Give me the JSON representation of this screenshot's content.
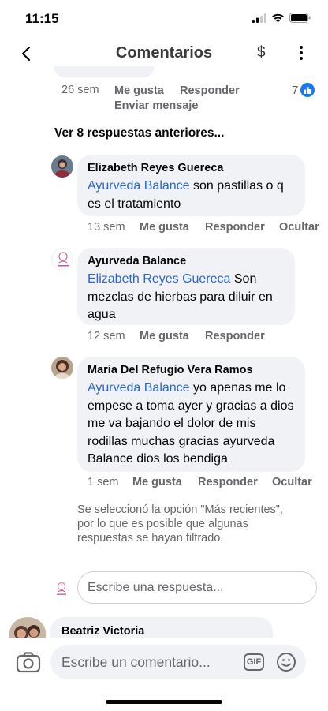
{
  "status_bar": {
    "time": "11:15"
  },
  "header": {
    "title": "Comentarios",
    "dollar_symbol": "$"
  },
  "parent_comment": {
    "time": "26 sem",
    "like_label": "Me gusta",
    "reply_label": "Responder",
    "send_message_label": "Enviar mensaje",
    "reaction_count": "7"
  },
  "previous_replies_label": "Ver 8 respuestas anteriores...",
  "replies": [
    {
      "author": "Elizabeth Reyes Guereca",
      "mention": "Ayurveda Balance",
      "text": " son pastillas o q es el tratamiento",
      "time": "13 sem",
      "like_label": "Me gusta",
      "reply_label": "Responder",
      "hide_label": "Ocultar"
    },
    {
      "author": "Ayurveda Balance",
      "mention": "Elizabeth Reyes Guereca",
      "text": " Son mezclas de hierbas para diluir en agua",
      "time": "12 sem",
      "like_label": "Me gusta",
      "reply_label": "Responder"
    },
    {
      "author": "Maria Del Refugio Vera Ramos",
      "mention": "Ayurveda Balance",
      "text": "  yo apenas me lo empese a toma ayer y gracias a dios me va bajando el dolor de mis rodillas muchas gracias ayurveda Balance dios los bendiga",
      "time": "1 sem",
      "like_label": "Me gusta",
      "reply_label": "Responder",
      "hide_label": "Ocultar"
    }
  ],
  "filter_notice": "Se seleccionó la opción \"Más recientes\", por lo que es posible que algunas respuestas se hayan filtrado.",
  "reply_input": {
    "placeholder": "Escribe una respuesta..."
  },
  "next_comment": {
    "author": "Beatriz Victoria"
  },
  "composer": {
    "placeholder": "Escribe un comentario...",
    "gif_label": "GIF"
  },
  "colors": {
    "link": "#2d66cc",
    "bubble": "#f0f2f5",
    "meta": "#65676b",
    "like": "#1877f2"
  },
  "icons": [
    "signal-icon",
    "wifi-icon",
    "battery-icon",
    "back-arrow-icon",
    "more-icon",
    "like-icon",
    "camera-icon",
    "gif-icon",
    "emoji-icon"
  ]
}
